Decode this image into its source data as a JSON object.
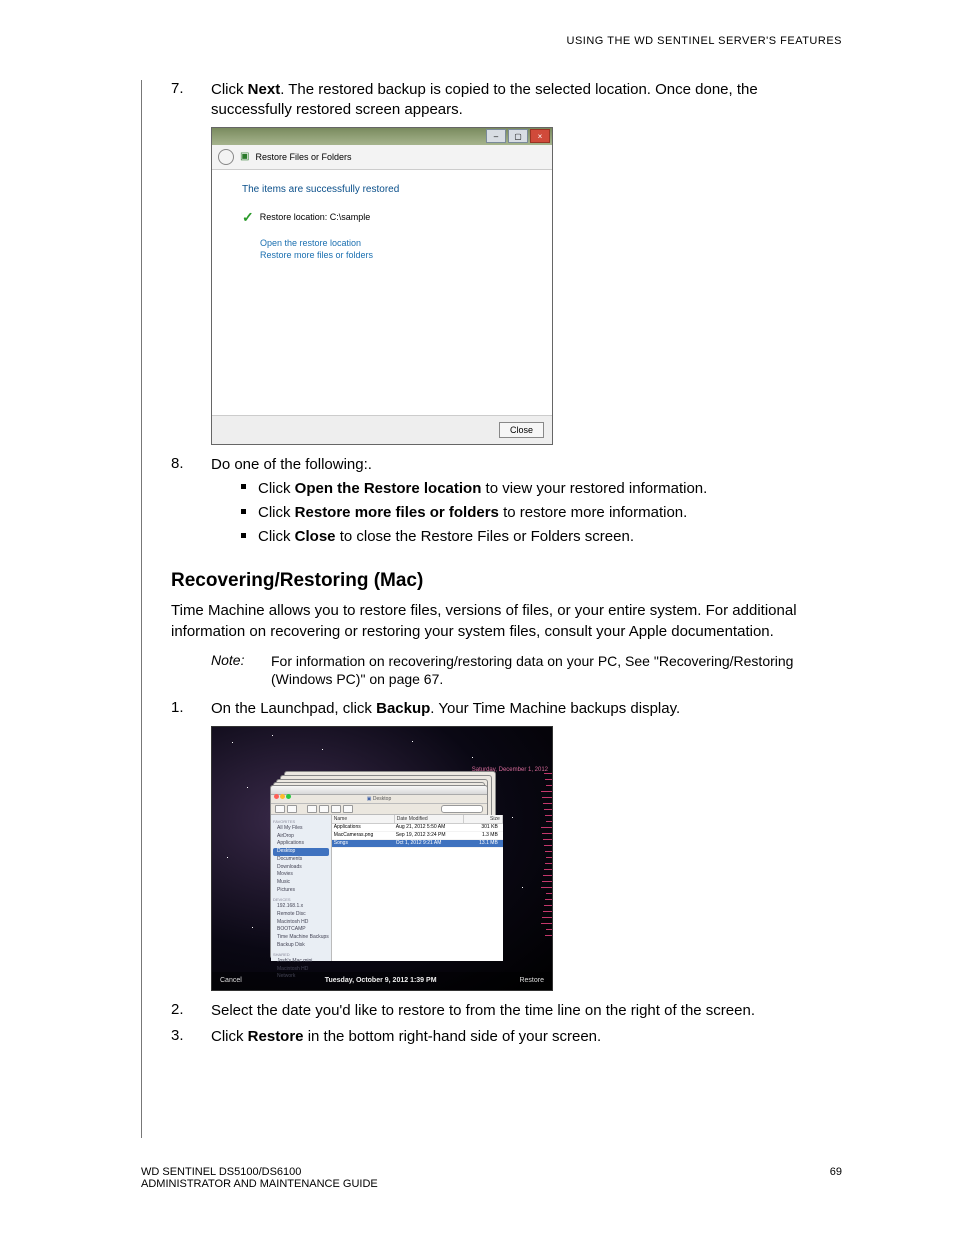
{
  "header": "USING THE WD SENTINEL SERVER'S FEATURES",
  "step7": {
    "num": "7.",
    "text_a": "Click ",
    "bold": "Next",
    "text_b": ". The restored backup is copied to the selected location. Once done, the successfully restored screen appears."
  },
  "dialog1": {
    "crumb": "Restore Files or Folders",
    "heading": "The items are successfully restored",
    "loc": "Restore location: C:\\sample",
    "link1": "Open the restore location",
    "link2": "Restore more files or folders",
    "close": "Close"
  },
  "step8": {
    "num": "8.",
    "text": "Do one of the following:.",
    "b1a": "Click ",
    "b1bold": "Open the Restore location",
    "b1b": " to view your restored information.",
    "b2a": "Click ",
    "b2bold": "Restore more files or folders",
    "b2b": " to restore more information.",
    "b3a": "Click ",
    "b3bold": "Close",
    "b3b": " to close the Restore Files or Folders screen."
  },
  "h2": "Recovering/Restoring (Mac)",
  "macpara": "Time Machine allows you to restore files, versions of files, or your entire system. For additional information on recovering or restoring your system files, consult your Apple documentation.",
  "note": {
    "label": "Note:",
    "text": "For information on recovering/restoring data on your PC, See \"Recovering/Restoring (Windows PC)\" on page 67."
  },
  "mac1": {
    "num": "1.",
    "a": "On the Launchpad, click ",
    "bold": "Backup",
    "b": ". Your Time Machine backups display."
  },
  "mac2": {
    "num": "2.",
    "text": "Select the date you'd like to restore to from the time line on the right of the screen."
  },
  "mac3": {
    "num": "3.",
    "a": "Click ",
    "bold": "Restore",
    "b": " in the bottom right-hand side of your screen."
  },
  "macshot": {
    "date_label": "Saturday, December 1, 2012",
    "path": "Desktop",
    "side": {
      "fav": "FAVORITES",
      "items_fav": [
        "All My Files",
        "AirDrop",
        "Applications",
        "Desktop",
        "Documents",
        "Downloads",
        "Movies",
        "Music",
        "Pictures"
      ],
      "dev": "DEVICES",
      "items_dev": [
        "192.168.1.x",
        "Remote Disc",
        "Macintosh HD",
        "BOOTCAMP",
        "Time Machine Backups",
        "Backup Disk"
      ],
      "shared": "SHARED",
      "items_shared": [
        "Josh's Mac mini",
        "Macintosh HD",
        "Network"
      ]
    },
    "cols": [
      "Name",
      "Date Modified",
      "Size"
    ],
    "rows": [
      [
        "Applications",
        "Aug 21, 2012 5:50 AM",
        "301 KB"
      ],
      [
        "MacCameras.png",
        "Sep 19, 2012 3:24 PM",
        "1.3 MB"
      ],
      [
        "Songs",
        "Oct 1, 2012 9:21 AM",
        "13.1 MB"
      ]
    ],
    "bottom_date": "Tuesday, October 9, 2012 1:39 PM",
    "cancel": "Cancel",
    "restore": "Restore"
  },
  "footer": {
    "left1": "WD SENTINEL DS5100/DS6100",
    "left2": "ADMINISTRATOR AND MAINTENANCE GUIDE",
    "page": "69"
  }
}
